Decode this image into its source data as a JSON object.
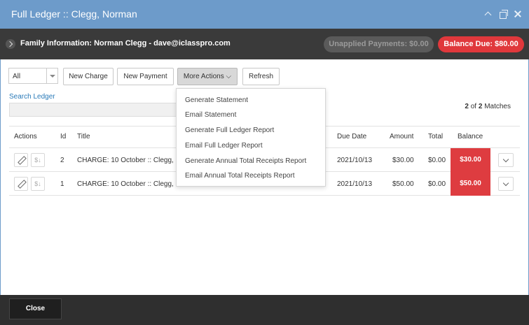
{
  "window": {
    "title": "Full Ledger :: Clegg, Norman"
  },
  "family_bar": {
    "info": "Family Information: Norman Clegg - dave@iclasspro.com",
    "unapplied": "Unapplied Payments: $0.00",
    "balance_due": "Balance Due: $80.00"
  },
  "toolbar": {
    "filter_value": "All",
    "new_charge": "New Charge",
    "new_payment": "New Payment",
    "more_actions": "More Actions",
    "refresh": "Refresh"
  },
  "search": {
    "label": "Search Ledger",
    "placeholder": ""
  },
  "matches": {
    "shown": "2",
    "of_text": "of",
    "total": "2",
    "suffix": "Matches"
  },
  "table": {
    "headers": [
      "Actions",
      "Id",
      "Title",
      "Due Date",
      "Amount",
      "Total",
      "Balance"
    ],
    "rows": [
      {
        "id": "2",
        "title": "CHARGE: 10 October :: Clegg, Na",
        "due_date": "2021/10/13",
        "amount": "$30.00",
        "total": "$0.00",
        "balance": "$30.00"
      },
      {
        "id": "1",
        "title": "CHARGE: 10 October :: Clegg, No",
        "due_date": "2021/10/13",
        "amount": "$50.00",
        "total": "$0.00",
        "balance": "$50.00"
      }
    ]
  },
  "more_actions_menu": [
    "Generate Statement",
    "Email Statement",
    "Generate Full Ledger Report",
    "Email Full Ledger Report",
    "Generate Annual Total Receipts Report",
    "Email Annual Total Receipts Report"
  ],
  "footer": {
    "close": "Close"
  },
  "colors": {
    "titlebar": "#6d9bca",
    "family_bar": "#3a3a3a",
    "balance_red": "#e0383c",
    "link_blue": "#2a7ab8",
    "footer": "#2f2f2f"
  },
  "icons": [
    "chevron-up-icon",
    "restore-icon",
    "close-icon",
    "chevron-right-icon",
    "select-arrow-icon",
    "pencil-icon",
    "dollar-icon",
    "chevron-down-icon"
  ]
}
